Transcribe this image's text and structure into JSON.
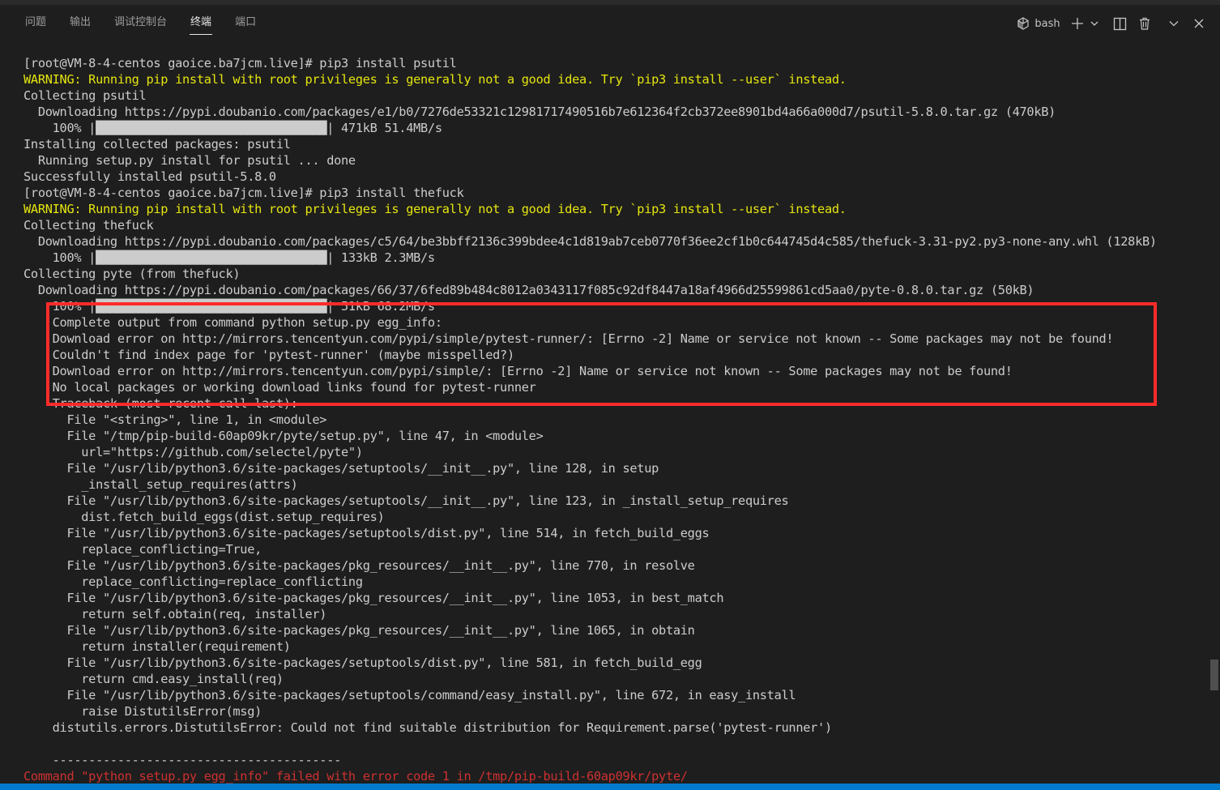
{
  "panel": {
    "tabs": [
      {
        "label": "问题"
      },
      {
        "label": "输出"
      },
      {
        "label": "调试控制台"
      },
      {
        "label": "终端"
      },
      {
        "label": "端口"
      }
    ],
    "active_tab": "终端",
    "shell_label": "bash",
    "icons": [
      "terminal-icon",
      "plus-icon",
      "chevron-down-icon",
      "split-icon",
      "trash-icon",
      "chevron-down-icon",
      "close-icon"
    ]
  },
  "colors": {
    "background": "#1e1e1e",
    "text": "#cccccc",
    "warning": "#e5e510",
    "error": "#cd3131",
    "highlight_box": "#ff2b2b",
    "status_bar": "#007acc"
  },
  "terminal": {
    "lines": [
      {
        "text": "[root@VM-8-4-centos gaoice.ba7jcm.live]# pip3 install psutil",
        "style": "normal"
      },
      {
        "text": "WARNING: Running pip install with root privileges is generally not a good idea. Try `pip3 install --user` instead.",
        "style": "yellow"
      },
      {
        "text": "Collecting psutil",
        "style": "normal"
      },
      {
        "text": "  Downloading https://pypi.doubanio.com/packages/e1/b0/7276de53321c12981717490516b7e612364f2cb372ee8901bd4a66a000d7/psutil-5.8.0.tar.gz (470kB)",
        "style": "normal"
      },
      {
        "text": "    100% |████████████████████████████████| 471kB 51.4MB/s",
        "style": "normal"
      },
      {
        "text": "Installing collected packages: psutil",
        "style": "normal"
      },
      {
        "text": "  Running setup.py install for psutil ... done",
        "style": "normal"
      },
      {
        "text": "Successfully installed psutil-5.8.0",
        "style": "normal"
      },
      {
        "text": "[root@VM-8-4-centos gaoice.ba7jcm.live]# pip3 install thefuck",
        "style": "normal"
      },
      {
        "text": "WARNING: Running pip install with root privileges is generally not a good idea. Try `pip3 install --user` instead.",
        "style": "yellow"
      },
      {
        "text": "Collecting thefuck",
        "style": "normal"
      },
      {
        "text": "  Downloading https://pypi.doubanio.com/packages/c5/64/be3bbff2136c399bdee4c1d819ab7ceb0770f36ee2cf1b0c644745d4c585/thefuck-3.31-py2.py3-none-any.whl (128kB)",
        "style": "normal"
      },
      {
        "text": "    100% |████████████████████████████████| 133kB 2.3MB/s",
        "style": "normal"
      },
      {
        "text": "Collecting pyte (from thefuck)",
        "style": "normal"
      },
      {
        "text": "  Downloading https://pypi.doubanio.com/packages/66/37/6fed89b484c8012a0343117f085c92df8447a18af4966d25599861cd5aa0/pyte-0.8.0.tar.gz (50kB)",
        "style": "normal"
      },
      {
        "text": "    100% |████████████████████████████████| 51kB 68.2MB/s",
        "style": "normal"
      },
      {
        "text": "    Complete output from command python setup.py egg_info:",
        "style": "normal"
      },
      {
        "text": "    Download error on http://mirrors.tencentyun.com/pypi/simple/pytest-runner/: [Errno -2] Name or service not known -- Some packages may not be found!",
        "style": "normal"
      },
      {
        "text": "    Couldn't find index page for 'pytest-runner' (maybe misspelled?)",
        "style": "normal"
      },
      {
        "text": "    Download error on http://mirrors.tencentyun.com/pypi/simple/: [Errno -2] Name or service not known -- Some packages may not be found!",
        "style": "normal"
      },
      {
        "text": "    No local packages or working download links found for pytest-runner",
        "style": "normal"
      },
      {
        "text": "    Traceback (most recent call last):",
        "style": "normal"
      },
      {
        "text": "      File \"<string>\", line 1, in <module>",
        "style": "normal"
      },
      {
        "text": "      File \"/tmp/pip-build-60ap09kr/pyte/setup.py\", line 47, in <module>",
        "style": "normal"
      },
      {
        "text": "        url=\"https://github.com/selectel/pyte\")",
        "style": "normal"
      },
      {
        "text": "      File \"/usr/lib/python3.6/site-packages/setuptools/__init__.py\", line 128, in setup",
        "style": "normal"
      },
      {
        "text": "        _install_setup_requires(attrs)",
        "style": "normal"
      },
      {
        "text": "      File \"/usr/lib/python3.6/site-packages/setuptools/__init__.py\", line 123, in _install_setup_requires",
        "style": "normal"
      },
      {
        "text": "        dist.fetch_build_eggs(dist.setup_requires)",
        "style": "normal"
      },
      {
        "text": "      File \"/usr/lib/python3.6/site-packages/setuptools/dist.py\", line 514, in fetch_build_eggs",
        "style": "normal"
      },
      {
        "text": "        replace_conflicting=True,",
        "style": "normal"
      },
      {
        "text": "      File \"/usr/lib/python3.6/site-packages/pkg_resources/__init__.py\", line 770, in resolve",
        "style": "normal"
      },
      {
        "text": "        replace_conflicting=replace_conflicting",
        "style": "normal"
      },
      {
        "text": "      File \"/usr/lib/python3.6/site-packages/pkg_resources/__init__.py\", line 1053, in best_match",
        "style": "normal"
      },
      {
        "text": "        return self.obtain(req, installer)",
        "style": "normal"
      },
      {
        "text": "      File \"/usr/lib/python3.6/site-packages/pkg_resources/__init__.py\", line 1065, in obtain",
        "style": "normal"
      },
      {
        "text": "        return installer(requirement)",
        "style": "normal"
      },
      {
        "text": "      File \"/usr/lib/python3.6/site-packages/setuptools/dist.py\", line 581, in fetch_build_egg",
        "style": "normal"
      },
      {
        "text": "        return cmd.easy_install(req)",
        "style": "normal"
      },
      {
        "text": "      File \"/usr/lib/python3.6/site-packages/setuptools/command/easy_install.py\", line 672, in easy_install",
        "style": "normal"
      },
      {
        "text": "        raise DistutilsError(msg)",
        "style": "normal"
      },
      {
        "text": "    distutils.errors.DistutilsError: Could not find suitable distribution for Requirement.parse('pytest-runner')",
        "style": "normal"
      },
      {
        "text": "",
        "style": "normal"
      },
      {
        "text": "    ----------------------------------------",
        "style": "normal"
      },
      {
        "text": "Command \"python setup.py egg_info\" failed with error code 1 in /tmp/pip-build-60ap09kr/pyte/",
        "style": "red"
      }
    ]
  }
}
